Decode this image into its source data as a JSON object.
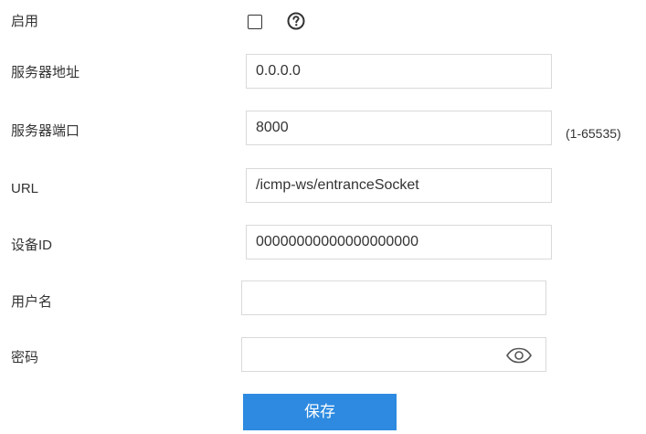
{
  "form": {
    "enable": {
      "label": "启用",
      "checked": false,
      "help_icon": "question-circle-icon"
    },
    "server_address": {
      "label": "服务器地址",
      "value": "0.0.0.0"
    },
    "server_port": {
      "label": "服务器端口",
      "value": "8000",
      "hint": "(1-65535)"
    },
    "url": {
      "label": "URL",
      "value": "/icmp-ws/entranceSocket"
    },
    "device_id": {
      "label": "设备ID",
      "value": "00000000000000000000"
    },
    "username": {
      "label": "用户名",
      "value": ""
    },
    "password": {
      "label": "密码",
      "value": "",
      "toggle_icon": "eye-icon"
    },
    "save_label": "保存"
  },
  "colors": {
    "primary": "#2d8ae0",
    "border": "#d9d9d9",
    "text": "#333333"
  }
}
